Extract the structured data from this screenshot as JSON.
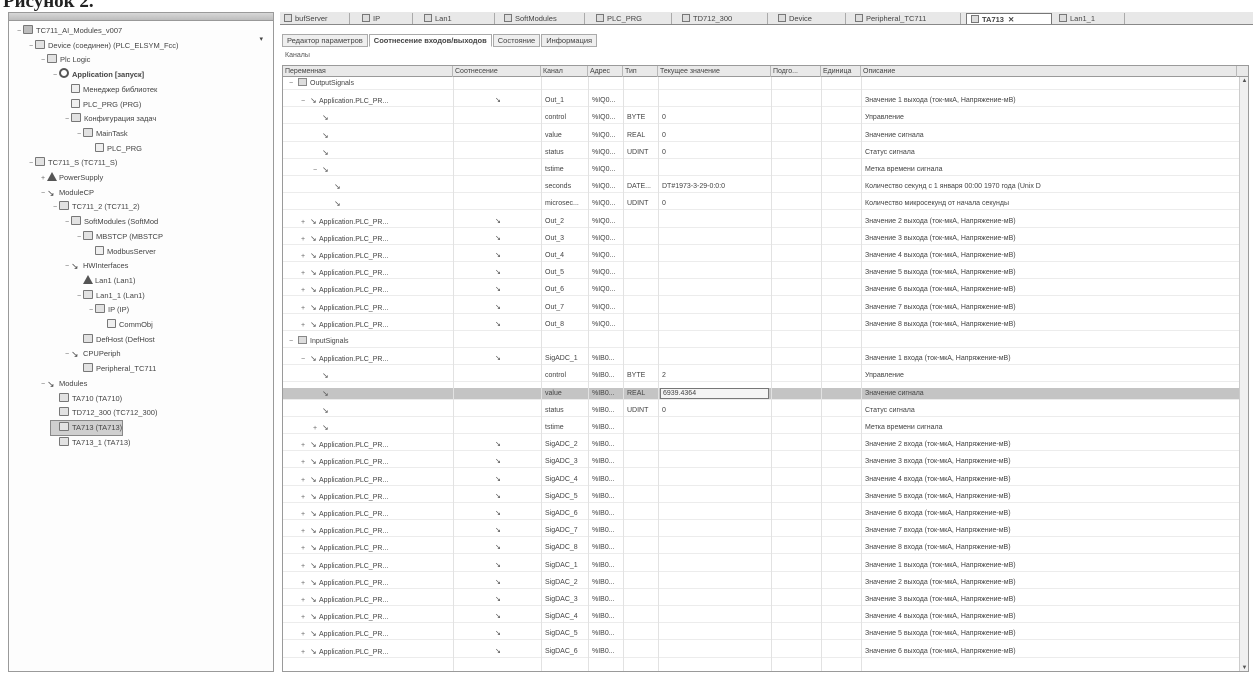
{
  "caption": "Рисунок 2.",
  "tree": {
    "dropdown": "▾",
    "nodes": [
      {
        "label": "TC711_AI_Modules_v007",
        "exp": "−",
        "icon": "root",
        "indent": 0
      },
      {
        "label": "Device (соединен) (PLC_ELSYM_Fcc)",
        "exp": "−",
        "icon": "device",
        "indent": 1
      },
      {
        "label": "Plc Logic",
        "exp": "−",
        "icon": "folder",
        "indent": 2
      },
      {
        "label": "Application [запуск]",
        "exp": "−",
        "icon": "app",
        "indent": 3,
        "bold": true
      },
      {
        "label": "Менеджер библиотек",
        "exp": "",
        "icon": "doc",
        "indent": 4
      },
      {
        "label": "PLC_PRG (PRG)",
        "exp": "",
        "icon": "doc",
        "indent": 4
      },
      {
        "label": "Конфигурация задач",
        "exp": "−",
        "icon": "folder",
        "indent": 4
      },
      {
        "label": "MainTask",
        "exp": "−",
        "icon": "folder",
        "indent": 5
      },
      {
        "label": "PLC_PRG",
        "exp": "",
        "icon": "doc",
        "indent": 6
      },
      {
        "label": "TC711_S (TC711_S)",
        "exp": "−",
        "icon": "device",
        "indent": 1
      },
      {
        "label": "PowerSupply",
        "exp": "+",
        "icon": "warn",
        "indent": 2
      },
      {
        "label": "ModuleCP",
        "exp": "−",
        "icon": "sig",
        "indent": 2
      },
      {
        "label": "TC711_2 (TC711_2)",
        "exp": "−",
        "icon": "device",
        "indent": 3
      },
      {
        "label": "SoftModules (SoftMod",
        "exp": "−",
        "icon": "folder",
        "indent": 4
      },
      {
        "label": "MBSTCP (MBSTCP",
        "exp": "−",
        "icon": "device",
        "indent": 5
      },
      {
        "label": "ModbusServer",
        "exp": "",
        "icon": "doc",
        "indent": 6
      },
      {
        "label": "HWInterfaces",
        "exp": "−",
        "icon": "sig",
        "indent": 4
      },
      {
        "label": "Lan1 (Lan1)",
        "exp": "",
        "icon": "warn",
        "indent": 5
      },
      {
        "label": "Lan1_1 (Lan1)",
        "exp": "−",
        "icon": "device",
        "indent": 5
      },
      {
        "label": "IP (IP)",
        "exp": "−",
        "icon": "device",
        "indent": 6
      },
      {
        "label": "CommObj",
        "exp": "",
        "icon": "doc",
        "indent": 7
      },
      {
        "label": "DefHost (DefHost",
        "exp": "",
        "icon": "device",
        "indent": 5
      },
      {
        "label": "CPUPeriph",
        "exp": "−",
        "icon": "sig",
        "indent": 4
      },
      {
        "label": "Peripheral_TC711",
        "exp": "",
        "icon": "device",
        "indent": 5
      },
      {
        "label": "Modules",
        "exp": "−",
        "icon": "sig",
        "indent": 2
      },
      {
        "label": "TA710 (TA710)",
        "exp": "",
        "icon": "device",
        "indent": 3
      },
      {
        "label": "TD712_300 (TC712_300)",
        "exp": "",
        "icon": "device",
        "indent": 3
      },
      {
        "label": "TA713 (TA713)",
        "exp": "",
        "icon": "device",
        "indent": 3,
        "selected": true
      },
      {
        "label": "TA713_1 (TA713)",
        "exp": "",
        "icon": "device",
        "indent": 3
      }
    ]
  },
  "doc_tabs": [
    {
      "label": "bufServer",
      "active": false
    },
    {
      "label": "IP",
      "active": false
    },
    {
      "label": "Lan1",
      "active": false
    },
    {
      "label": "SoftModules",
      "active": false
    },
    {
      "label": "PLC_PRG",
      "active": false
    },
    {
      "label": "TD712_300",
      "active": false
    },
    {
      "label": "Device",
      "active": false
    },
    {
      "label": "Peripheral_TC711",
      "active": false
    },
    {
      "label": "TA713",
      "active": true,
      "close": "✕"
    },
    {
      "label": "Lan1_1",
      "active": false
    }
  ],
  "sub_tabs": [
    {
      "label": "Редактор параметров",
      "active": false
    },
    {
      "label": "Соотнесение входов/выходов",
      "active": true
    },
    {
      "label": "Состояние",
      "active": false
    },
    {
      "label": "Информация",
      "active": false
    }
  ],
  "channels_label": "Каналы",
  "columns": [
    "Переменная",
    "Соотнесение",
    "Канал",
    "Адрес",
    "Тип",
    "Текущее значение",
    "Подго...",
    "Единица",
    "Описание"
  ],
  "rows": [
    {
      "level": 0,
      "exp": "−",
      "kind": "group",
      "var": "OutputSignals"
    },
    {
      "level": 1,
      "exp": "−",
      "kind": "var",
      "var": "Application.PLC_PR...",
      "map": "↘",
      "chan": "Out_1",
      "addr": "%IQ0...",
      "type": "",
      "val": "",
      "desc": "Значение 1 выхода (ток-мкА, Напряжение-мВ)"
    },
    {
      "level": 2,
      "exp": "",
      "kind": "var",
      "var": "",
      "map": "",
      "chan": "control",
      "addr": "%IQ0...",
      "type": "BYTE",
      "val": "0",
      "desc": "Управление"
    },
    {
      "level": 2,
      "exp": "",
      "kind": "var",
      "var": "",
      "map": "",
      "chan": "value",
      "addr": "%IQ0...",
      "type": "REAL",
      "val": "0",
      "desc": "Значение сигнала"
    },
    {
      "level": 2,
      "exp": "",
      "kind": "var",
      "var": "",
      "map": "",
      "chan": "status",
      "addr": "%IQ0...",
      "type": "UDINT",
      "val": "0",
      "desc": "Статус сигнала"
    },
    {
      "level": 2,
      "exp": "−",
      "kind": "var",
      "var": "",
      "map": "",
      "chan": "tstime",
      "addr": "%IQ0...",
      "type": "",
      "val": "",
      "desc": "Метка времени сигнала"
    },
    {
      "level": 3,
      "exp": "",
      "kind": "var",
      "var": "",
      "map": "",
      "chan": "seconds",
      "addr": "%IQ0...",
      "type": "DATE...",
      "val": "DT#1973-3-29-0:0:0",
      "desc": "Количество секунд с 1 января 00:00 1970 года (Unix D"
    },
    {
      "level": 3,
      "exp": "",
      "kind": "var",
      "var": "",
      "map": "",
      "chan": "microsec...",
      "addr": "%IQ0...",
      "type": "UDINT",
      "val": "0",
      "desc": "Количество микросекунд от начала секунды"
    },
    {
      "level": 1,
      "exp": "+",
      "kind": "var",
      "var": "Application.PLC_PR...",
      "map": "↘",
      "chan": "Out_2",
      "addr": "%IQ0...",
      "type": "",
      "val": "",
      "desc": "Значение 2 выхода (ток-мкА, Напряжение-мВ)"
    },
    {
      "level": 1,
      "exp": "+",
      "kind": "var",
      "var": "Application.PLC_PR...",
      "map": "↘",
      "chan": "Out_3",
      "addr": "%IQ0...",
      "type": "",
      "val": "",
      "desc": "Значение 3 выхода (ток-мкА, Напряжение-мВ)"
    },
    {
      "level": 1,
      "exp": "+",
      "kind": "var",
      "var": "Application.PLC_PR...",
      "map": "↘",
      "chan": "Out_4",
      "addr": "%IQ0...",
      "type": "",
      "val": "",
      "desc": "Значение 4 выхода (ток-мкА, Напряжение-мВ)"
    },
    {
      "level": 1,
      "exp": "+",
      "kind": "var",
      "var": "Application.PLC_PR...",
      "map": "↘",
      "chan": "Out_5",
      "addr": "%IQ0...",
      "type": "",
      "val": "",
      "desc": "Значение 5 выхода (ток-мкА, Напряжение-мВ)"
    },
    {
      "level": 1,
      "exp": "+",
      "kind": "var",
      "var": "Application.PLC_PR...",
      "map": "↘",
      "chan": "Out_6",
      "addr": "%IQ0...",
      "type": "",
      "val": "",
      "desc": "Значение 6 выхода (ток-мкА, Напряжение-мВ)"
    },
    {
      "level": 1,
      "exp": "+",
      "kind": "var",
      "var": "Application.PLC_PR...",
      "map": "↘",
      "chan": "Out_7",
      "addr": "%IQ0...",
      "type": "",
      "val": "",
      "desc": "Значение 7 выхода (ток-мкА, Напряжение-мВ)"
    },
    {
      "level": 1,
      "exp": "+",
      "kind": "var",
      "var": "Application.PLC_PR...",
      "map": "↘",
      "chan": "Out_8",
      "addr": "%IQ0...",
      "type": "",
      "val": "",
      "desc": "Значение 8 выхода (ток-мкА, Напряжение-мВ)"
    },
    {
      "level": 0,
      "exp": "−",
      "kind": "group",
      "var": "InputSignals"
    },
    {
      "level": 1,
      "exp": "−",
      "kind": "var",
      "var": "Application.PLC_PR...",
      "map": "↘",
      "chan": "SigADC_1",
      "addr": "%IB0...",
      "type": "",
      "val": "",
      "desc": "Значение 1 входа (ток-мкА, Напряжение-мВ)"
    },
    {
      "level": 2,
      "exp": "",
      "kind": "var",
      "var": "",
      "map": "",
      "chan": "control",
      "addr": "%IB0...",
      "type": "BYTE",
      "val": "2",
      "desc": "Управление"
    },
    {
      "level": 2,
      "exp": "",
      "kind": "var",
      "var": "",
      "map": "",
      "chan": "value",
      "addr": "%IB0...",
      "type": "REAL",
      "val": "6939.4364",
      "desc": "Значение сигнала",
      "highlight": true
    },
    {
      "level": 2,
      "exp": "",
      "kind": "var",
      "var": "",
      "map": "",
      "chan": "status",
      "addr": "%IB0...",
      "type": "UDINT",
      "val": "0",
      "desc": "Статус сигнала"
    },
    {
      "level": 2,
      "exp": "+",
      "kind": "var",
      "var": "",
      "map": "",
      "chan": "tstime",
      "addr": "%IB0...",
      "type": "",
      "val": "",
      "desc": "Метка времени сигнала"
    },
    {
      "level": 1,
      "exp": "+",
      "kind": "var",
      "var": "Application.PLC_PR...",
      "map": "↘",
      "chan": "SigADC_2",
      "addr": "%IB0...",
      "type": "",
      "val": "",
      "desc": "Значение 2 входа (ток-мкА, Напряжение-мВ)"
    },
    {
      "level": 1,
      "exp": "+",
      "kind": "var",
      "var": "Application.PLC_PR...",
      "map": "↘",
      "chan": "SigADC_3",
      "addr": "%IB0...",
      "type": "",
      "val": "",
      "desc": "Значение 3 входа (ток-мкА, Напряжение-мВ)"
    },
    {
      "level": 1,
      "exp": "+",
      "kind": "var",
      "var": "Application.PLC_PR...",
      "map": "↘",
      "chan": "SigADC_4",
      "addr": "%IB0...",
      "type": "",
      "val": "",
      "desc": "Значение 4 входа (ток-мкА, Напряжение-мВ)"
    },
    {
      "level": 1,
      "exp": "+",
      "kind": "var",
      "var": "Application.PLC_PR...",
      "map": "↘",
      "chan": "SigADC_5",
      "addr": "%IB0...",
      "type": "",
      "val": "",
      "desc": "Значение 5 входа (ток-мкА, Напряжение-мВ)"
    },
    {
      "level": 1,
      "exp": "+",
      "kind": "var",
      "var": "Application.PLC_PR...",
      "map": "↘",
      "chan": "SigADC_6",
      "addr": "%IB0...",
      "type": "",
      "val": "",
      "desc": "Значение 6 входа (ток-мкА, Напряжение-мВ)"
    },
    {
      "level": 1,
      "exp": "+",
      "kind": "var",
      "var": "Application.PLC_PR...",
      "map": "↘",
      "chan": "SigADC_7",
      "addr": "%IB0...",
      "type": "",
      "val": "",
      "desc": "Значение 7 входа (ток-мкА, Напряжение-мВ)"
    },
    {
      "level": 1,
      "exp": "+",
      "kind": "var",
      "var": "Application.PLC_PR...",
      "map": "↘",
      "chan": "SigADC_8",
      "addr": "%IB0...",
      "type": "",
      "val": "",
      "desc": "Значение 8 входа (ток-мкА, Напряжение-мВ)"
    },
    {
      "level": 1,
      "exp": "+",
      "kind": "var",
      "var": "Application.PLC_PR...",
      "map": "↘",
      "chan": "SigDAC_1",
      "addr": "%IB0...",
      "type": "",
      "val": "",
      "desc": "Значение 1 выхода (ток-мкА, Напряжение-мВ)"
    },
    {
      "level": 1,
      "exp": "+",
      "kind": "var",
      "var": "Application.PLC_PR...",
      "map": "↘",
      "chan": "SigDAC_2",
      "addr": "%IB0...",
      "type": "",
      "val": "",
      "desc": "Значение 2 выхода (ток-мкА, Напряжение-мВ)"
    },
    {
      "level": 1,
      "exp": "+",
      "kind": "var",
      "var": "Application.PLC_PR...",
      "map": "↘",
      "chan": "SigDAC_3",
      "addr": "%IB0...",
      "type": "",
      "val": "",
      "desc": "Значение 3 выхода (ток-мкА, Напряжение-мВ)"
    },
    {
      "level": 1,
      "exp": "+",
      "kind": "var",
      "var": "Application.PLC_PR...",
      "map": "↘",
      "chan": "SigDAC_4",
      "addr": "%IB0...",
      "type": "",
      "val": "",
      "desc": "Значение 4 выхода (ток-мкА, Напряжение-мВ)"
    },
    {
      "level": 1,
      "exp": "+",
      "kind": "var",
      "var": "Application.PLC_PR...",
      "map": "↘",
      "chan": "SigDAC_5",
      "addr": "%IB0...",
      "type": "",
      "val": "",
      "desc": "Значение 5 выхода (ток-мкА, Напряжение-мВ)"
    },
    {
      "level": 1,
      "exp": "+",
      "kind": "var",
      "var": "Application.PLC_PR...",
      "map": "↘",
      "chan": "SigDAC_6",
      "addr": "%IB0...",
      "type": "",
      "val": "",
      "desc": "Значение 6 выхода (ток-мкА, Напряжение-мВ)"
    }
  ],
  "scrollbar": {
    "up": "▲",
    "down": "▼"
  }
}
